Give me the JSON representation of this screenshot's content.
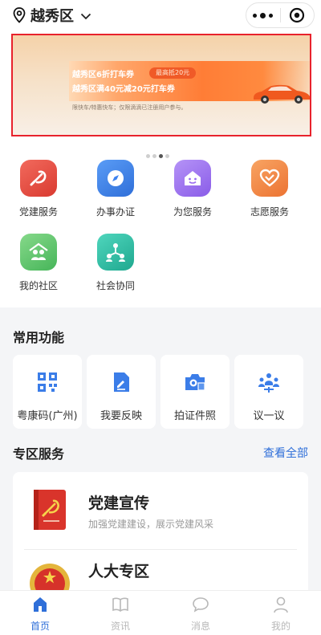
{
  "header": {
    "location": "越秀区"
  },
  "banner": {
    "line1": "越秀区6折打车券",
    "pill": "最高抵20元",
    "line2": "越秀区满40元减20元打车券",
    "note": "限快车/特惠快车；仅限滴滴已注册用户参与。"
  },
  "services": [
    {
      "label": "党建服务",
      "icon": "party-icon",
      "color": "#e8453c"
    },
    {
      "label": "办事办证",
      "icon": "compass-icon",
      "color": "#3d82f0"
    },
    {
      "label": "为您服务",
      "icon": "house-smile-icon",
      "color": "#9b6cf0"
    },
    {
      "label": "志愿服务",
      "icon": "heart-icon",
      "color": "#f38a45"
    },
    {
      "label": "我的社区",
      "icon": "community-icon",
      "color": "#5cc46a"
    },
    {
      "label": "社会协同",
      "icon": "network-icon",
      "color": "#2fbfa6"
    }
  ],
  "common": {
    "title": "常用功能",
    "items": [
      {
        "label": "粤康码(广州)",
        "icon": "qr-code-icon"
      },
      {
        "label": "我要反映",
        "icon": "edit-doc-icon"
      },
      {
        "label": "拍证件照",
        "icon": "camera-icon"
      },
      {
        "label": "议一议",
        "icon": "discussion-icon"
      }
    ]
  },
  "zones": {
    "title": "专区服务",
    "view_all": "查看全部",
    "items": [
      {
        "title": "党建宣传",
        "subtitle": "加强党建建设，展示党建风采",
        "icon": "party-book-icon"
      },
      {
        "title": "人大专区",
        "subtitle": "",
        "icon": "national-emblem-icon"
      }
    ]
  },
  "tabs": [
    {
      "label": "首页",
      "icon": "home-icon",
      "active": true
    },
    {
      "label": "资讯",
      "icon": "book-icon",
      "active": false
    },
    {
      "label": "消息",
      "icon": "chat-icon",
      "active": false
    },
    {
      "label": "我的",
      "icon": "user-icon",
      "active": false
    }
  ],
  "colors": {
    "accent": "#2f6fd9",
    "banner_border": "#e8222c"
  }
}
